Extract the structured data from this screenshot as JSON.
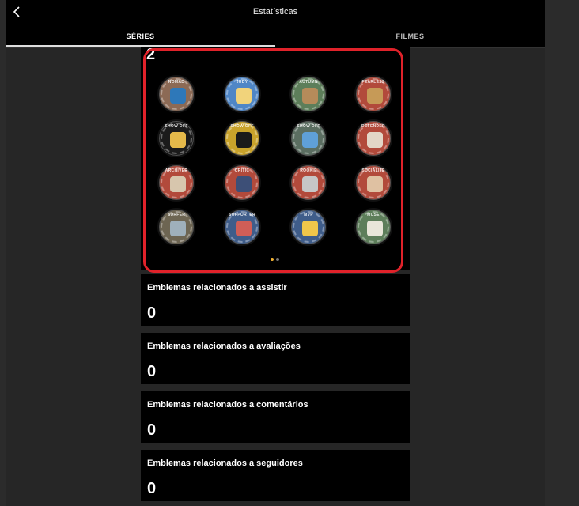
{
  "header": {
    "title": "Estatísticas",
    "back_icon": "chevron-left-icon"
  },
  "tabs": [
    {
      "label": "SÉRIES",
      "active": true
    },
    {
      "label": "FILMES",
      "active": false
    }
  ],
  "badges_section": {
    "count": "2",
    "badges": [
      {
        "label": "NOMAD",
        "color": "#8c6a55",
        "center": "#2e78b9"
      },
      {
        "label": "JUDY",
        "color": "#4f86c6",
        "center": "#f1d37b"
      },
      {
        "label": "AUTUMN",
        "color": "#5d7e5a",
        "center": "#b68b5a"
      },
      {
        "label": "FEARLESS",
        "color": "#b24a3b",
        "center": "#c69a57"
      },
      {
        "label": "SHOW OFF",
        "color": "#1b1b1b",
        "center": "#e5b94a"
      },
      {
        "label": "SHOW OFF",
        "color": "#c9a32b",
        "center": "#1a1a1a"
      },
      {
        "label": "SHOW OFF",
        "color": "#5b6e61",
        "center": "#5fa0d8"
      },
      {
        "label": "DEFENDER",
        "color": "#b24a3b",
        "center": "#e3d6c6"
      },
      {
        "label": "ARCHIVER",
        "color": "#b24a3b",
        "center": "#d7c6ad"
      },
      {
        "label": "CRITIC",
        "color": "#b24a3b",
        "center": "#3d4f77"
      },
      {
        "label": "ROOKIE",
        "color": "#b24a3b",
        "center": "#c6c6c6"
      },
      {
        "label": "SOCIALITE",
        "color": "#b24a3b",
        "center": "#dfc1a2"
      },
      {
        "label": "SURFER",
        "color": "#6d6552",
        "center": "#9fb0bb"
      },
      {
        "label": "SUPPORTER",
        "color": "#3f5d8a",
        "center": "#d05e57"
      },
      {
        "label": "MVP",
        "color": "#3f5d8a",
        "center": "#f0c64a"
      },
      {
        "label": "MUSE",
        "color": "#5d7e5a",
        "center": "#e8e6d9"
      }
    ],
    "pagination": {
      "current": 1,
      "total": 2,
      "active_color": "#f2b233",
      "inactive_color": "#777777"
    }
  },
  "stats": [
    {
      "label": "Emblemas relacionados a assistir",
      "value": "0"
    },
    {
      "label": "Emblemas relacionados a avaliações",
      "value": "0"
    },
    {
      "label": "Emblemas relacionados a comentários",
      "value": "0"
    },
    {
      "label": "Emblemas relacionados a seguidores",
      "value": "0"
    }
  ]
}
